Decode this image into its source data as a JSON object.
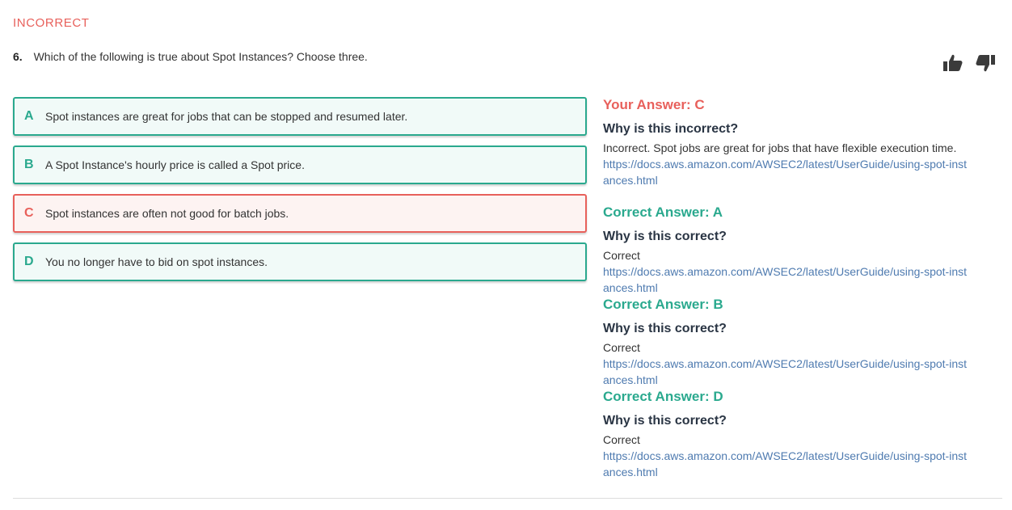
{
  "status_label": "INCORRECT",
  "question": {
    "number": "6.",
    "text": "Which of the following is true about Spot Instances? Choose three."
  },
  "feedback": {
    "thumbs_up_icon": "thumbs-up-icon",
    "thumbs_down_icon": "thumbs-down-icon"
  },
  "options": [
    {
      "letter": "A",
      "text": "Spot instances are great for jobs that can be stopped and resumed later.",
      "state": "correct"
    },
    {
      "letter": "B",
      "text": "A Spot Instance's hourly price is called a Spot price.",
      "state": "correct"
    },
    {
      "letter": "C",
      "text": "Spot instances are often not good for batch jobs.",
      "state": "wrong"
    },
    {
      "letter": "D",
      "text": "You no longer have to bid on spot instances.",
      "state": "correct"
    }
  ],
  "your_answer": {
    "heading": "Your Answer: C",
    "why": "Why is this incorrect?",
    "explanation": "Incorrect. Spot jobs are great for jobs that have flexible execution time.",
    "link": "https://docs.aws.amazon.com/AWSEC2/latest/UserGuide/using-spot-instances.html"
  },
  "correct_answers": [
    {
      "heading": "Correct Answer: A",
      "why": "Why is this correct?",
      "explanation": "Correct",
      "link": "https://docs.aws.amazon.com/AWSEC2/latest/UserGuide/using-spot-instances.html"
    },
    {
      "heading": "Correct Answer: B",
      "why": "Why is this correct?",
      "explanation": "Correct",
      "link": "https://docs.aws.amazon.com/AWSEC2/latest/UserGuide/using-spot-instances.html"
    },
    {
      "heading": "Correct Answer: D",
      "why": "Why is this correct?",
      "explanation": "Correct",
      "link": "https://docs.aws.amazon.com/AWSEC2/latest/UserGuide/using-spot-instances.html"
    }
  ],
  "colors": {
    "incorrect": "#e8605b",
    "correct": "#2aa98e",
    "link": "#4f7bb0"
  }
}
